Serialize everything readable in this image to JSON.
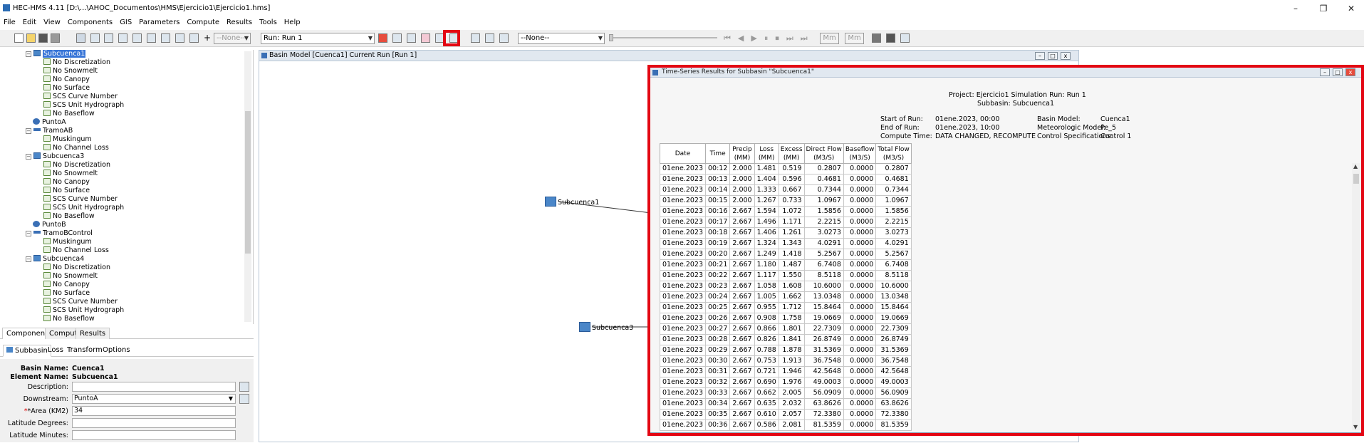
{
  "window": {
    "title": "HEC-HMS 4.11 [D:\\...\\AHOC_Documentos\\HMS\\Ejercicio1\\Ejercicio1.hms]",
    "minimize": "–",
    "maximize": "❐",
    "close": "✕"
  },
  "menu": [
    "File",
    "Edit",
    "View",
    "Components",
    "GIS",
    "Parameters",
    "Compute",
    "Results",
    "Tools",
    "Help"
  ],
  "toolbar": {
    "run_select": "Run: Run 1",
    "none1": "--None--",
    "none2": "--None--",
    "mm1": "Mm",
    "mm2": "Mm"
  },
  "tree": [
    {
      "label": "Subcuenca1",
      "kind": "sub",
      "selected": true
    },
    {
      "label": "No Discretization",
      "kind": "method"
    },
    {
      "label": "No Snowmelt",
      "kind": "method"
    },
    {
      "label": "No Canopy",
      "kind": "method"
    },
    {
      "label": "No Surface",
      "kind": "method"
    },
    {
      "label": "SCS Curve Number",
      "kind": "method"
    },
    {
      "label": "SCS Unit Hydrograph",
      "kind": "method"
    },
    {
      "label": "No Baseflow",
      "kind": "method"
    },
    {
      "label": "PuntoA",
      "kind": "junc"
    },
    {
      "label": "TramoAB",
      "kind": "reach"
    },
    {
      "label": "Muskingum",
      "kind": "method"
    },
    {
      "label": "No Channel Loss",
      "kind": "method"
    },
    {
      "label": "Subcuenca3",
      "kind": "sub"
    },
    {
      "label": "No Discretization",
      "kind": "method"
    },
    {
      "label": "No Snowmelt",
      "kind": "method"
    },
    {
      "label": "No Canopy",
      "kind": "method"
    },
    {
      "label": "No Surface",
      "kind": "method"
    },
    {
      "label": "SCS Curve Number",
      "kind": "method"
    },
    {
      "label": "SCS Unit Hydrograph",
      "kind": "method"
    },
    {
      "label": "No Baseflow",
      "kind": "method"
    },
    {
      "label": "PuntoB",
      "kind": "junc"
    },
    {
      "label": "TramoBControl",
      "kind": "reach"
    },
    {
      "label": "Muskingum",
      "kind": "method"
    },
    {
      "label": "No Channel Loss",
      "kind": "method"
    },
    {
      "label": "Subcuenca4",
      "kind": "sub"
    },
    {
      "label": "No Discretization",
      "kind": "method"
    },
    {
      "label": "No Snowmelt",
      "kind": "method"
    },
    {
      "label": "No Canopy",
      "kind": "method"
    },
    {
      "label": "No Surface",
      "kind": "method"
    },
    {
      "label": "SCS Curve Number",
      "kind": "method"
    },
    {
      "label": "SCS Unit Hydrograph",
      "kind": "method"
    },
    {
      "label": "No Baseflow",
      "kind": "method"
    }
  ],
  "watershed_tabs": [
    "Components",
    "Compute",
    "Results"
  ],
  "property_tabs": [
    "Subbasin",
    "Loss",
    "Transform",
    "Options"
  ],
  "props": {
    "basin_name_label": "Basin Name:",
    "basin_name": "Cuenca1",
    "element_name_label": "Element Name:",
    "element_name": "Subcuenca1",
    "description_label": "Description:",
    "description": "",
    "downstream_label": "Downstream:",
    "downstream": "PuntoA",
    "area_label": "*Area (KM2)",
    "area": "34",
    "lat_deg_label": "Latitude Degrees:",
    "lat_min_label": "Latitude Minutes:"
  },
  "basin_window": {
    "title": "Basin Model [Cuenca1] Current Run [Run 1]",
    "elements": [
      "Subcuenca1",
      "Subcuenca3"
    ]
  },
  "results": {
    "title": "Time-Series Results for Subbasin \"Subcuenca1\"",
    "project_line": "Project: Ejercicio1    Simulation Run: Run 1",
    "subbasin_line": "Subbasin: Subcuenca1",
    "start_label": "Start of Run:",
    "start": "01ene.2023, 00:00",
    "end_label": "End of Run:",
    "end": "01ene.2023, 10:00",
    "compute_label": "Compute Time:",
    "compute": "DATA CHANGED, RECOMPUTE",
    "basin_label": "Basin Model:",
    "basin": "Cuenca1",
    "met_label": "Meteorologic Model:",
    "met": "Pe_5",
    "control_label": "Control Specifications:",
    "control": "Control 1",
    "columns": [
      "Date",
      "Time",
      "Precip\n(MM)",
      "Loss\n(MM)",
      "Excess\n(MM)",
      "Direct Flow\n(M3/S)",
      "Baseflow\n(M3/S)",
      "Total Flow\n(M3/S)"
    ],
    "rows": [
      [
        "01ene.2023",
        "00:12",
        "2.000",
        "1.481",
        "0.519",
        "0.2807",
        "0.0000",
        "0.2807"
      ],
      [
        "01ene.2023",
        "00:13",
        "2.000",
        "1.404",
        "0.596",
        "0.4681",
        "0.0000",
        "0.4681"
      ],
      [
        "01ene.2023",
        "00:14",
        "2.000",
        "1.333",
        "0.667",
        "0.7344",
        "0.0000",
        "0.7344"
      ],
      [
        "01ene.2023",
        "00:15",
        "2.000",
        "1.267",
        "0.733",
        "1.0967",
        "0.0000",
        "1.0967"
      ],
      [
        "01ene.2023",
        "00:16",
        "2.667",
        "1.594",
        "1.072",
        "1.5856",
        "0.0000",
        "1.5856"
      ],
      [
        "01ene.2023",
        "00:17",
        "2.667",
        "1.496",
        "1.171",
        "2.2215",
        "0.0000",
        "2.2215"
      ],
      [
        "01ene.2023",
        "00:18",
        "2.667",
        "1.406",
        "1.261",
        "3.0273",
        "0.0000",
        "3.0273"
      ],
      [
        "01ene.2023",
        "00:19",
        "2.667",
        "1.324",
        "1.343",
        "4.0291",
        "0.0000",
        "4.0291"
      ],
      [
        "01ene.2023",
        "00:20",
        "2.667",
        "1.249",
        "1.418",
        "5.2567",
        "0.0000",
        "5.2567"
      ],
      [
        "01ene.2023",
        "00:21",
        "2.667",
        "1.180",
        "1.487",
        "6.7408",
        "0.0000",
        "6.7408"
      ],
      [
        "01ene.2023",
        "00:22",
        "2.667",
        "1.117",
        "1.550",
        "8.5118",
        "0.0000",
        "8.5118"
      ],
      [
        "01ene.2023",
        "00:23",
        "2.667",
        "1.058",
        "1.608",
        "10.6000",
        "0.0000",
        "10.6000"
      ],
      [
        "01ene.2023",
        "00:24",
        "2.667",
        "1.005",
        "1.662",
        "13.0348",
        "0.0000",
        "13.0348"
      ],
      [
        "01ene.2023",
        "00:25",
        "2.667",
        "0.955",
        "1.712",
        "15.8464",
        "0.0000",
        "15.8464"
      ],
      [
        "01ene.2023",
        "00:26",
        "2.667",
        "0.908",
        "1.758",
        "19.0669",
        "0.0000",
        "19.0669"
      ],
      [
        "01ene.2023",
        "00:27",
        "2.667",
        "0.866",
        "1.801",
        "22.7309",
        "0.0000",
        "22.7309"
      ],
      [
        "01ene.2023",
        "00:28",
        "2.667",
        "0.826",
        "1.841",
        "26.8749",
        "0.0000",
        "26.8749"
      ],
      [
        "01ene.2023",
        "00:29",
        "2.667",
        "0.788",
        "1.878",
        "31.5369",
        "0.0000",
        "31.5369"
      ],
      [
        "01ene.2023",
        "00:30",
        "2.667",
        "0.753",
        "1.913",
        "36.7548",
        "0.0000",
        "36.7548"
      ],
      [
        "01ene.2023",
        "00:31",
        "2.667",
        "0.721",
        "1.946",
        "42.5648",
        "0.0000",
        "42.5648"
      ],
      [
        "01ene.2023",
        "00:32",
        "2.667",
        "0.690",
        "1.976",
        "49.0003",
        "0.0000",
        "49.0003"
      ],
      [
        "01ene.2023",
        "00:33",
        "2.667",
        "0.662",
        "2.005",
        "56.0909",
        "0.0000",
        "56.0909"
      ],
      [
        "01ene.2023",
        "00:34",
        "2.667",
        "0.635",
        "2.032",
        "63.8626",
        "0.0000",
        "63.8626"
      ],
      [
        "01ene.2023",
        "00:35",
        "2.667",
        "0.610",
        "2.057",
        "72.3380",
        "0.0000",
        "72.3380"
      ],
      [
        "01ene.2023",
        "00:36",
        "2.667",
        "0.586",
        "2.081",
        "81.5359",
        "0.0000",
        "81.5359"
      ]
    ]
  },
  "colors": {
    "highlight": "#e30613",
    "selection": "#3875d7",
    "element_blue": "#3a6fb5"
  }
}
